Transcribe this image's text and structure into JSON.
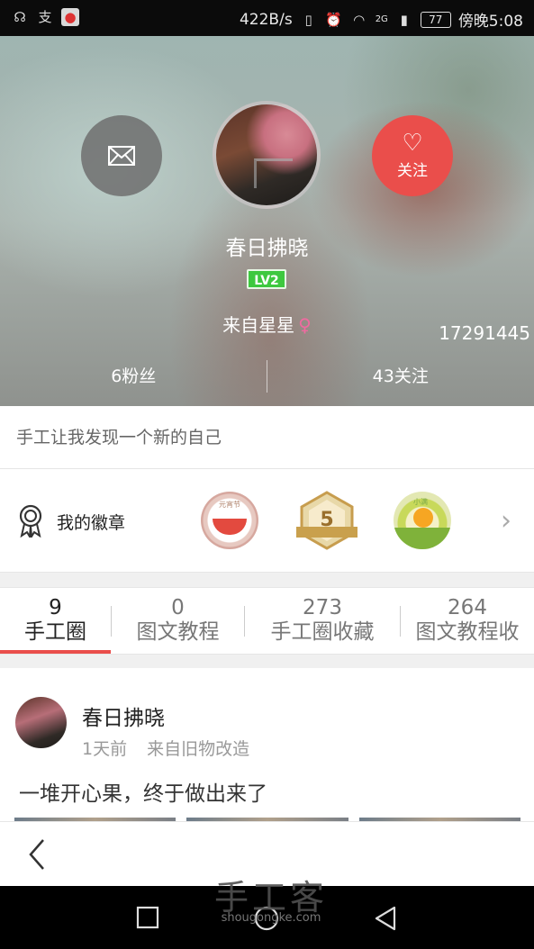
{
  "status_bar": {
    "left_icons": [
      "headset-icon",
      "alipay-icon",
      "map-icon"
    ],
    "net_speed": "422B/s",
    "network_badge": "2G",
    "battery": "77",
    "time": "傍晚5:08"
  },
  "profile": {
    "name": "春日拂晓",
    "level": "LV2",
    "from": "来自星星",
    "gender_symbol": "♀",
    "user_id": "17291445",
    "follow_label": "关注",
    "followers": "6粉丝",
    "following": "43关注",
    "bio": "手工让我发现一个新的自己"
  },
  "badges": {
    "label": "我的徽章",
    "badge_texts": [
      "元宵节",
      "5",
      "小满"
    ]
  },
  "tabs": [
    {
      "count": "9",
      "label": "手工圈"
    },
    {
      "count": "0",
      "label": "图文教程"
    },
    {
      "count": "273",
      "label": "手工圈收藏"
    },
    {
      "count": "264",
      "label": "图文教程收"
    }
  ],
  "post": {
    "author": "春日拂晓",
    "time": "1天前",
    "source": "来自旧物改造",
    "text": "一堆开心果，终于做出来了"
  },
  "watermark": {
    "big": "手工客",
    "small": "shougongke.com"
  },
  "colors": {
    "accent": "#ea4e4b",
    "level_badge": "#3ec83f"
  }
}
